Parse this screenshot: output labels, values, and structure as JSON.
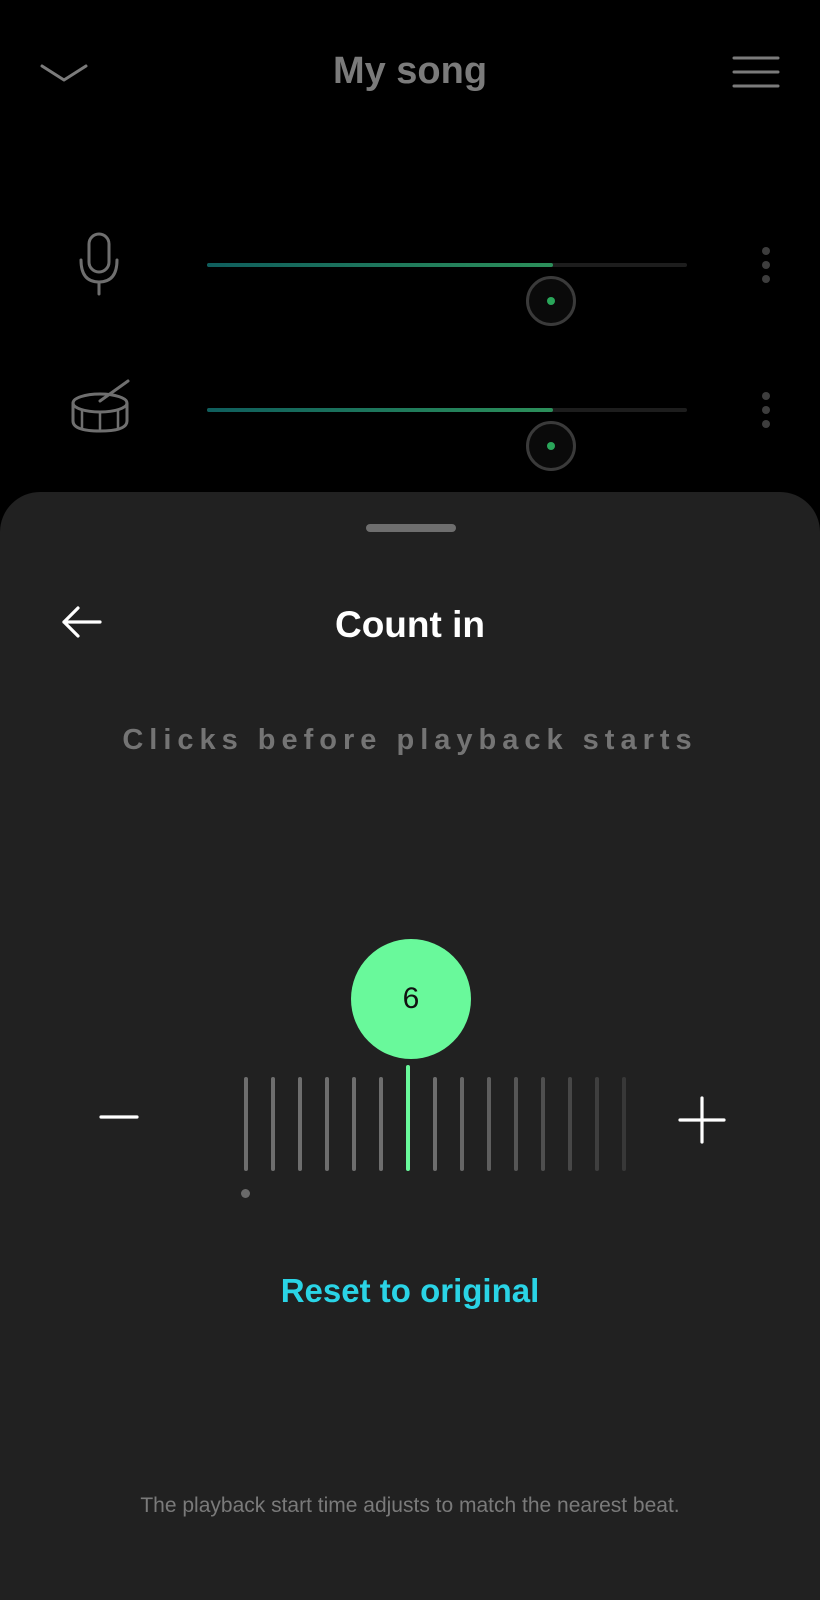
{
  "header": {
    "title": "My song",
    "collapse_icon": "chevron-down-icon",
    "menu_icon": "hamburger-menu-icon"
  },
  "tracks": [
    {
      "icon": "microphone-icon",
      "volume": 0.72
    },
    {
      "icon": "drum-icon",
      "volume": 0.72
    }
  ],
  "sheet": {
    "title": "Count in",
    "subtitle": "Clicks before playback starts",
    "back_icon": "arrow-left-icon",
    "value": "6",
    "selected_index": 6,
    "reset_label": "Reset to original",
    "footnote": "The playback start time adjusts to match the nearest beat."
  },
  "colors": {
    "accent_green": "#69f99b",
    "link_cyan": "#2ad4e6",
    "sheet_bg": "#212121",
    "app_bg": "#000000"
  }
}
